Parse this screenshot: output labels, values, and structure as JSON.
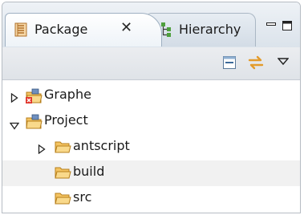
{
  "tabs": [
    {
      "label": "Package",
      "icon": "package-explorer-icon",
      "close": "✕"
    },
    {
      "label": "Hierarchy",
      "icon": "type-hierarchy-icon"
    }
  ],
  "window_controls": {
    "minimize": "minimize-icon",
    "maximize": "maximize-icon"
  },
  "toolbar": {
    "buttons": [
      "collapse-all-icon",
      "link-with-editor-icon",
      "view-menu-icon"
    ]
  },
  "tree": [
    {
      "label": "Graphe",
      "level": 0,
      "expanded": false,
      "icon": "project-error-icon"
    },
    {
      "label": "Project",
      "level": 0,
      "expanded": true,
      "icon": "project-icon"
    },
    {
      "label": "antscript",
      "level": 1,
      "expanded": false,
      "icon": "folder-icon"
    },
    {
      "label": "build",
      "level": 1,
      "expanded": null,
      "icon": "folder-icon",
      "selected": true
    },
    {
      "label": "src",
      "level": 1,
      "expanded": null,
      "icon": "folder-icon"
    }
  ],
  "colors": {
    "accent": "#e8a33a",
    "selection": "#f1f1f1",
    "border": "#b6bcc3"
  }
}
